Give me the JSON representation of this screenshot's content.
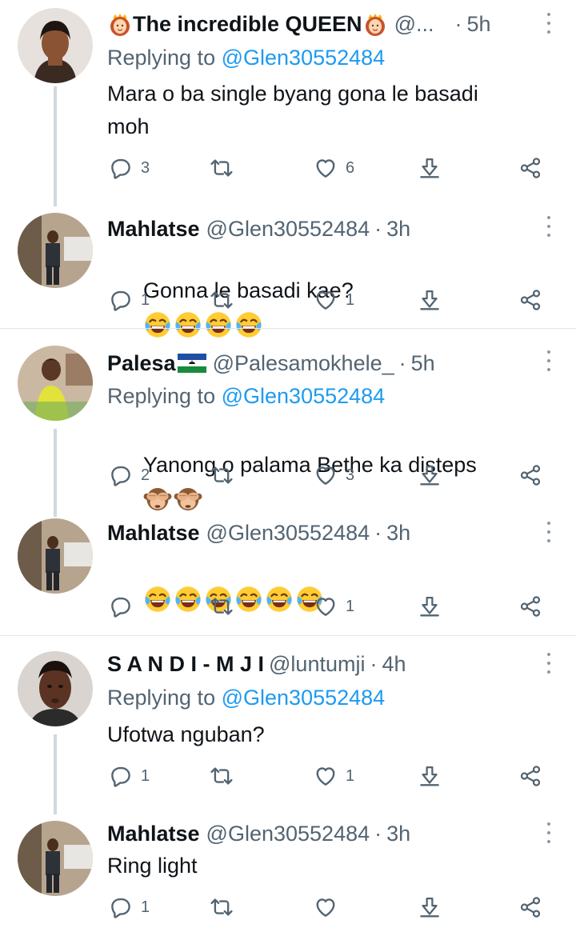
{
  "tweets": [
    {
      "name": "The incredible QUEEN",
      "handle": "@...",
      "time": "5h",
      "replying_label": "Replying to",
      "replying_mention": "@Glen30552484",
      "text": "Mara o ba single byang gona le basadi\nmoh",
      "replies": "3",
      "retweets": "",
      "likes": "6"
    },
    {
      "name": "Mahlatse",
      "handle": "@Glen30552484",
      "time": "3h",
      "text": "Gonna le basadi kae?",
      "emoji": [
        "tears-of-joy",
        "tears-of-joy",
        "tears-of-joy",
        "tears-of-joy"
      ],
      "replies": "1",
      "retweets": "",
      "likes": "1"
    },
    {
      "name": "Palesa",
      "handle": "@Palesamokhele_",
      "time": "5h",
      "replying_label": "Replying to",
      "replying_mention": "@Glen30552484",
      "text": "Yanong o palama Bethe ka disteps",
      "emoji": [
        "see-no-evil-monkey",
        "see-no-evil-monkey"
      ],
      "replies": "2",
      "retweets": "",
      "likes": "3"
    },
    {
      "name": "Mahlatse",
      "handle": "@Glen30552484",
      "time": "3h",
      "text": "",
      "emoji": [
        "tears-of-joy",
        "tears-of-joy",
        "tears-of-joy",
        "tears-of-joy",
        "tears-of-joy",
        "tears-of-joy"
      ],
      "replies": "",
      "retweets": "",
      "likes": "1"
    },
    {
      "name": "S A N D I - M J I",
      "handle": "@luntumji",
      "time": "4h",
      "replying_label": "Replying to",
      "replying_mention": "@Glen30552484",
      "text": "Ufotwa nguban?",
      "replies": "1",
      "retweets": "",
      "likes": "1"
    },
    {
      "name": "Mahlatse",
      "handle": "@Glen30552484",
      "time": "3h",
      "text": "Ring light",
      "replies": "1",
      "retweets": "",
      "likes": ""
    }
  ],
  "dot_separator": "·",
  "colors": {
    "text": "#0f1419",
    "muted": "#536471",
    "mention": "#1d9bf0",
    "thread_line": "#cfd9de",
    "divider": "#e1e6ea"
  },
  "icons": {
    "reply": "reply-icon",
    "retweet": "retweet-icon",
    "like": "heart-icon",
    "bookmark": "download-arrow-icon",
    "share": "share-icon",
    "more": "more-vertical-icon"
  }
}
